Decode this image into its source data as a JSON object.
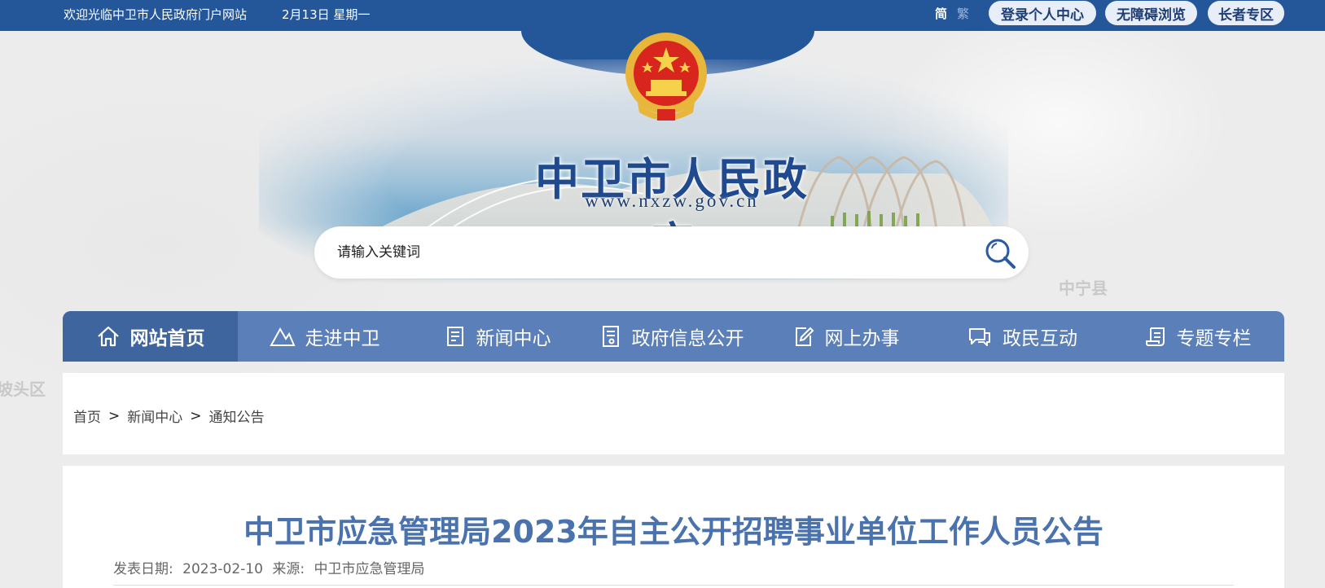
{
  "topbar": {
    "welcome": "欢迎光临中卫市人民政府门户网站",
    "date": "2月13日 星期一",
    "lang_simplified": "简",
    "lang_traditional": "繁",
    "login": "登录个人中心",
    "accessibility": "无障碍浏览",
    "elder": "长者专区"
  },
  "banner": {
    "title": "中卫市人民政府",
    "url": "www.nxzw.gov.cn"
  },
  "map_labels": [
    "中宁县",
    "坡头区"
  ],
  "search": {
    "placeholder": "请输入关键词"
  },
  "nav": {
    "items": [
      {
        "label": "网站首页",
        "icon": "home-icon"
      },
      {
        "label": "走进中卫",
        "icon": "mountain-icon"
      },
      {
        "label": "新闻中心",
        "icon": "news-icon"
      },
      {
        "label": "政府信息公开",
        "icon": "document-icon"
      },
      {
        "label": "网上办事",
        "icon": "edit-icon"
      },
      {
        "label": "政民互动",
        "icon": "chat-icon"
      },
      {
        "label": "专题专栏",
        "icon": "scroll-icon"
      }
    ]
  },
  "breadcrumb": {
    "items": [
      "首页",
      "新闻中心",
      "通知公告"
    ],
    "separator": ">"
  },
  "article": {
    "title": "中卫市应急管理局2023年自主公开招聘事业单位工作人员公告",
    "date_label": "发表日期:",
    "date": "2023-02-10",
    "source_label": "来源:",
    "source": "中卫市应急管理局"
  },
  "colors": {
    "topbar": "#24569a",
    "nav": "#5b7fb8",
    "nav_active": "#3e659e",
    "title": "#4a72ad"
  }
}
